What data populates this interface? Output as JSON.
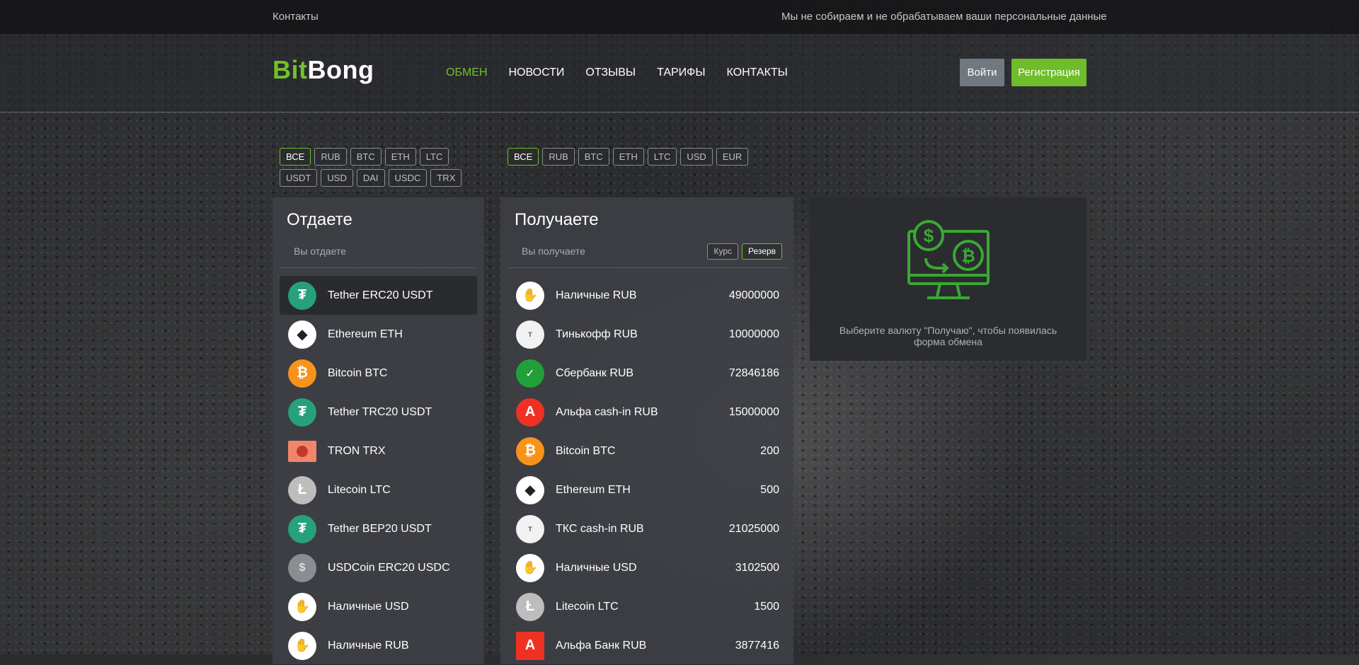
{
  "topbar": {
    "contacts": "Контакты",
    "privacy": "Мы не собираем и не обрабатываем ваши персональные данные"
  },
  "header": {
    "logo_green": "Bit",
    "logo_white": "Bong",
    "nav": [
      "ОБМЕН",
      "НОВОСТИ",
      "ОТЗЫВЫ",
      "ТАРИФЫ",
      "КОНТАКТЫ"
    ],
    "active_nav": "ОБМЕН",
    "login": "Войти",
    "register": "Регистрация"
  },
  "give_filters": [
    "ВСЕ",
    "RUB",
    "BTC",
    "ETH",
    "LTC",
    "USDT",
    "USD",
    "DAI",
    "USDC",
    "TRX"
  ],
  "get_filters": [
    "ВСЕ",
    "RUB",
    "BTC",
    "ETH",
    "LTC",
    "USD",
    "EUR"
  ],
  "give": {
    "title": "Отдаете",
    "subtitle": "Вы отдаете",
    "items": [
      {
        "label": "Tether ERC20 USDT",
        "icon": "tether-icon",
        "active": true
      },
      {
        "label": "Ethereum ETH",
        "icon": "ethereum-icon"
      },
      {
        "label": "Bitcoin BTC",
        "icon": "bitcoin-icon"
      },
      {
        "label": "Tether TRC20 USDT",
        "icon": "tether-icon"
      },
      {
        "label": "TRON TRX",
        "icon": "tron-icon"
      },
      {
        "label": "Litecoin LTC",
        "icon": "litecoin-icon"
      },
      {
        "label": "Tether BEP20 USDT",
        "icon": "tether-icon"
      },
      {
        "label": "USDCoin ERC20 USDC",
        "icon": "usdc-icon"
      },
      {
        "label": "Наличные USD",
        "icon": "cash-hand-icon"
      },
      {
        "label": "Наличные RUB",
        "icon": "cash-hand-icon"
      }
    ]
  },
  "get": {
    "title": "Получаете",
    "subtitle": "Вы получаете",
    "rate_btn": "Курс",
    "reserve_btn": "Резерв",
    "items": [
      {
        "label": "Наличные RUB",
        "amount": "49000000",
        "icon": "cash-hand-icon"
      },
      {
        "label": "Тинькофф RUB",
        "amount": "10000000",
        "icon": "tinkoff-icon"
      },
      {
        "label": "Сбербанк RUB",
        "amount": "72846186",
        "icon": "sberbank-icon"
      },
      {
        "label": "Альфа cash-in RUB",
        "amount": "15000000",
        "icon": "alfa-icon"
      },
      {
        "label": "Bitcoin BTC",
        "amount": "200",
        "icon": "bitcoin-icon"
      },
      {
        "label": "Ethereum ETH",
        "amount": "500",
        "icon": "ethereum-icon"
      },
      {
        "label": "ТКС cash-in RUB",
        "amount": "21025000",
        "icon": "tinkoff-icon"
      },
      {
        "label": "Наличные USD",
        "amount": "3102500",
        "icon": "cash-hand-icon"
      },
      {
        "label": "Litecoin LTC",
        "amount": "1500",
        "icon": "litecoin-icon"
      },
      {
        "label": "Альфа Банк RUB",
        "amount": "3877416",
        "icon": "alfa-icon"
      }
    ]
  },
  "info": {
    "text": "Выберите валюту \"Получаю\", чтобы появилась форма обмена"
  },
  "colors": {
    "accent": "#72c02c",
    "tether": "#26a17b",
    "bitcoin": "#f7931a",
    "alfa": "#ef3124",
    "sber": "#21a038"
  }
}
